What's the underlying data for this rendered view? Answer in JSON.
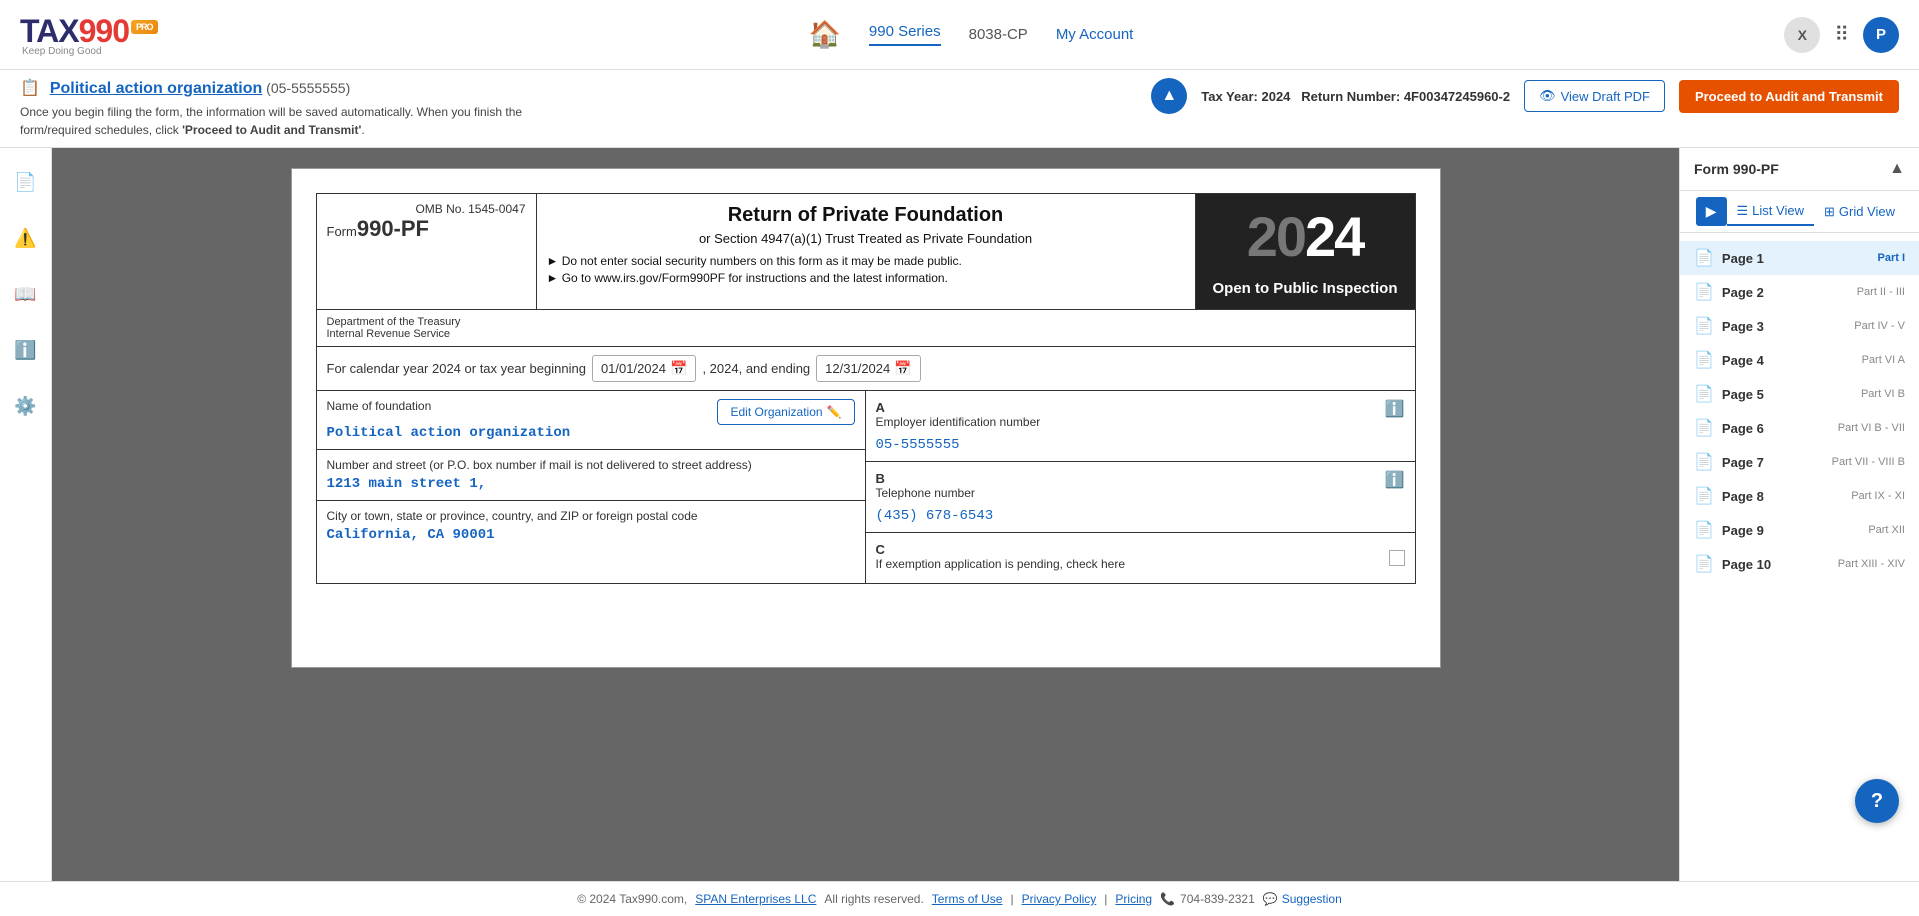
{
  "logo": {
    "tax": "TAX",
    "nine90": "990",
    "pro_badge": "PRO",
    "tagline": "Keep Doing Good"
  },
  "header": {
    "nav_home_icon": "🏠",
    "series_label": "990 Series",
    "separator_label": "8038-CP",
    "my_account_label": "My Account",
    "user_initial": "P",
    "x_label": "X"
  },
  "sub_header": {
    "org_name": "Political action organization",
    "org_ein": "(05-5555555)",
    "description_line1": "Once you begin filing the form, the information will be saved automatically. When you finish the",
    "description_line2": "form/required schedules, click ",
    "description_bold": "'Proceed to Audit and Transmit'",
    "description_end": ".",
    "tax_year_label": "Tax Year:",
    "tax_year_value": "2024",
    "return_number_label": "Return Number:",
    "return_number_value": "4F00347245960-2",
    "view_draft_label": "View Draft PDF",
    "proceed_btn_label": "Proceed to Audit and Transmit",
    "chevron_up": "▲"
  },
  "form": {
    "omb": "OMB No. 1545-0047",
    "form_label": "Form",
    "form_number": "990-PF",
    "main_title": "Return of Private Foundation",
    "subtitle": "or Section 4947(a)(1) Trust Treated as Private Foundation",
    "instruction1": "► Do not enter social security numbers on this form as it may be made public.",
    "instruction2": "► Go to www.irs.gov/Form990PF for instructions and the latest information.",
    "year_display": "2024",
    "open_inspection": "Open to Public Inspection",
    "dept_line1": "Department of the Treasury",
    "dept_line2": "Internal Revenue Service",
    "calendar_label": "For calendar year 2024 or tax year beginning",
    "date_start": "01/01/2024",
    "date_and": ", 2024, and ending",
    "date_end": "12/31/2024",
    "name_label": "Name of foundation",
    "edit_org_label": "Edit Organization",
    "org_name_value": "Political action organization",
    "address_label": "Number and street (or P.O. box number if mail is not delivered to street address)",
    "address_value": "1213 main street 1,",
    "city_label": "City or town, state or province, country, and ZIP or foreign postal code",
    "city_value": "California, CA 90001",
    "field_a_label": "Employer identification number",
    "field_a_value": "05-5555555",
    "field_b_label": "Telephone number",
    "field_b_value": "(435) 678-6543",
    "field_c_label": "If exemption application is pending, check here"
  },
  "right_sidebar": {
    "title": "Form 990-PF",
    "list_view_label": "List View",
    "grid_view_label": "Grid View",
    "pages": [
      {
        "num": "Page 1",
        "part": "Part I",
        "active": true
      },
      {
        "num": "Page 2",
        "part": "Part II - III"
      },
      {
        "num": "Page 3",
        "part": "Part IV - V"
      },
      {
        "num": "Page 4",
        "part": "Part VI A"
      },
      {
        "num": "Page 5",
        "part": "Part VI B"
      },
      {
        "num": "Page 6",
        "part": "Part VI B - VII"
      },
      {
        "num": "Page 7",
        "part": "Part VII - VIII B"
      },
      {
        "num": "Page 8",
        "part": "Part IX - XI"
      },
      {
        "num": "Page 9",
        "part": "Part XII"
      },
      {
        "num": "Page 10",
        "part": "Part XIII - XIV"
      }
    ]
  },
  "footer": {
    "copyright": "© 2024 Tax990.com,",
    "span_link": "SPAN Enterprises LLC",
    "rights": "All rights reserved.",
    "terms_link": "Terms of Use",
    "separator1": "|",
    "privacy_link": "Privacy Policy",
    "separator2": "|",
    "pricing_link": "Pricing",
    "phone": "704-839-2321",
    "suggestion": "Suggestion"
  },
  "help_btn_label": "?"
}
